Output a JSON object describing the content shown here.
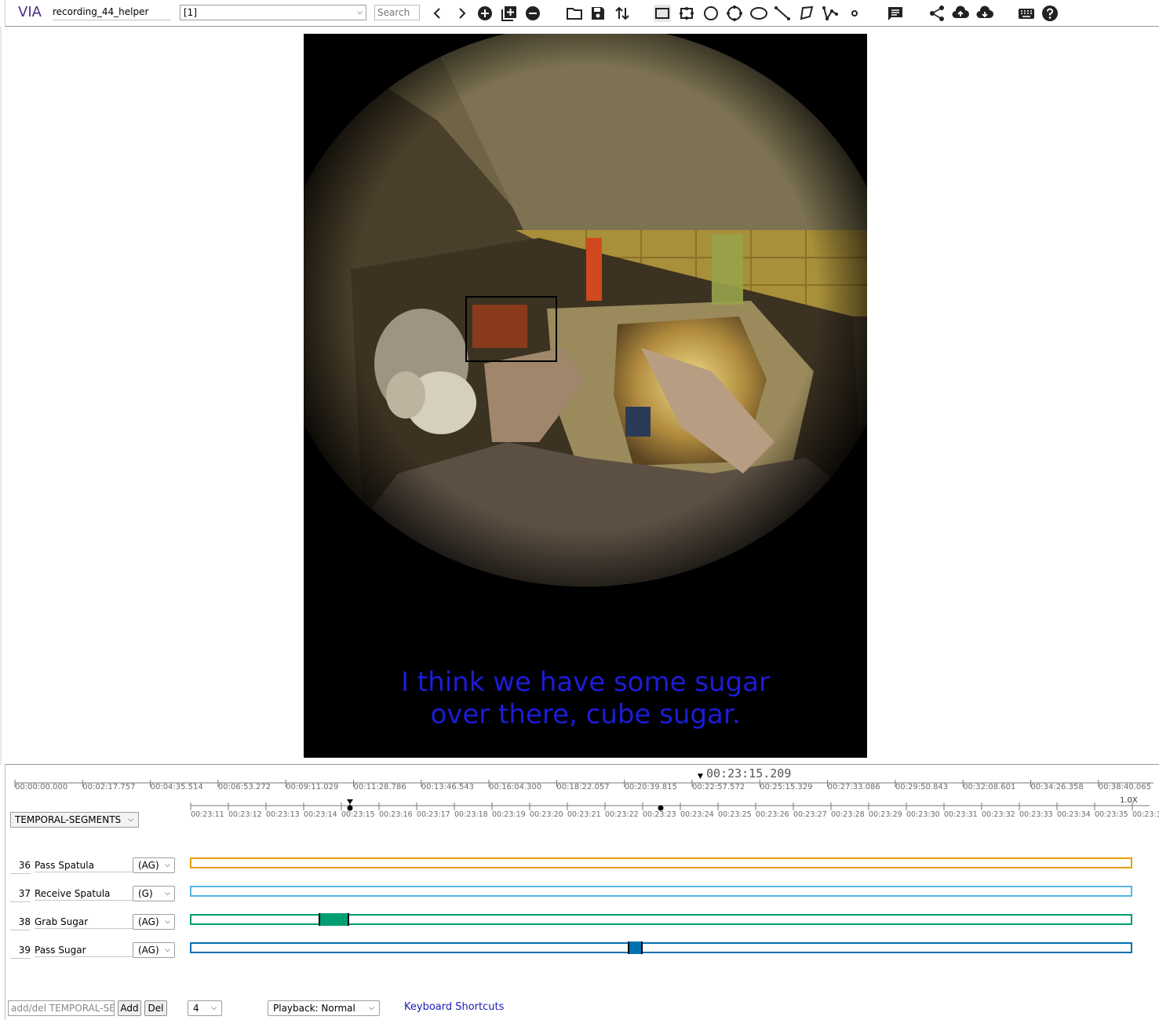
{
  "toolbar": {
    "brand": "VIA",
    "project_name": "recording_44_helper",
    "file_selector": "[1]",
    "search_placeholder": "Search"
  },
  "icons": [
    "prev-icon",
    "next-icon",
    "add-file-icon",
    "add-multiple-icon",
    "remove-file-icon",
    "open-folder-icon",
    "save-icon",
    "import-export-icon",
    "rect-shape-icon",
    "extreme-rect-icon",
    "circle-shape-icon",
    "extreme-circle-icon",
    "ellipse-shape-icon",
    "line-shape-icon",
    "polygon-shape-icon",
    "polyline-shape-icon",
    "point-shape-icon",
    "comment-icon",
    "share-icon",
    "upload-cloud-icon",
    "download-cloud-icon",
    "keyboard-icon",
    "help-icon"
  ],
  "video": {
    "subtitle": "I think we have some sugar\nover there, cube sugar.",
    "subtitle_color": "#1c1cd9"
  },
  "timeline": {
    "current_time": "00:23:15.209",
    "full_ticks": [
      "00:00:00.000",
      "00:02:17.757",
      "00:04:35.514",
      "00:06:53.272",
      "00:09:11.029",
      "00:11:28.786",
      "00:13:46.543",
      "00:16:04.300",
      "00:18:22.057",
      "00:20:39.815",
      "00:22:57.572",
      "00:25:15.329",
      "00:27:33.086",
      "00:29:50.843",
      "00:32:08.601",
      "00:34:26.358",
      "00:38:40.065"
    ],
    "zoom_ticks": [
      "00:23:11",
      "00:23:12",
      "00:23:13",
      "00:23:14",
      "00:23:15",
      "00:23:16",
      "00:23:17",
      "00:23:18",
      "00:23:19",
      "00:23:20",
      "00:23:21",
      "00:23:22",
      "00:23:23",
      "00:23:24",
      "00:23:25",
      "00:23:26",
      "00:23:27",
      "00:23:28",
      "00:23:29",
      "00:23:30",
      "00:23:31",
      "00:23:32",
      "00:23:33",
      "00:23:34",
      "00:23:35",
      "00:23:3"
    ],
    "zoom_level": "1.0X",
    "group_selector": "TEMPORAL-SEGMENTS"
  },
  "rows": [
    {
      "id": "36",
      "name": "Pass Spatula",
      "type": "(AG)",
      "color": "#e69f00",
      "segment": null
    },
    {
      "id": "37",
      "name": "Receive Spatula",
      "type": "(G)",
      "color": "#56b4e9",
      "segment": null
    },
    {
      "id": "38",
      "name": "Grab Sugar",
      "type": "(AG)",
      "color": "#009e73",
      "segment": {
        "start": "00:23:14.4",
        "end": "00:23:15.2"
      }
    },
    {
      "id": "39",
      "name": "Pass Sugar",
      "type": "(AG)",
      "color": "#0072b2",
      "segment": {
        "start": "00:23:22.6",
        "end": "00:23:23.0"
      }
    }
  ],
  "bottom": {
    "input_placeholder": "add/del TEMPORAL-SEGMENTS",
    "add_label": "Add",
    "del_label": "Del",
    "rows_select": "4",
    "playback_select": "Playback: Normal",
    "keyboard_link": "Keyboard Shortcuts"
  }
}
